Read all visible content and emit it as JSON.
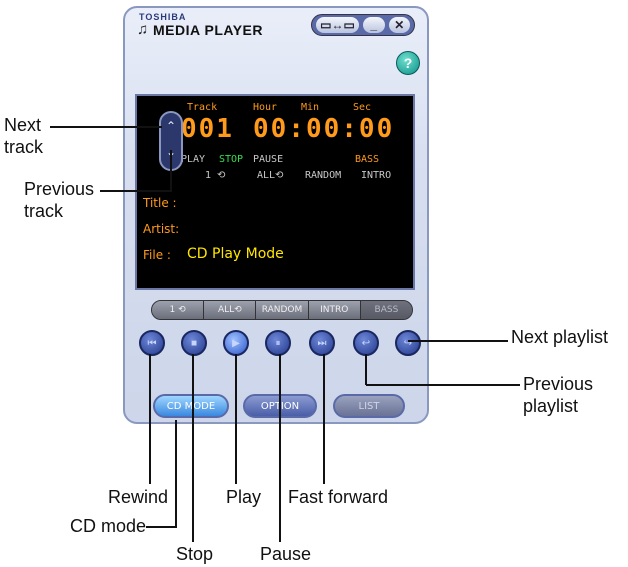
{
  "player": {
    "brand_small": "TOSHIBA",
    "title": "MEDIA PLAYER",
    "help": "?",
    "window_buttons": [
      "▭↔▭",
      "_",
      "✕"
    ],
    "display": {
      "labels": {
        "track": "Track",
        "hour": "Hour",
        "min": "Min",
        "sec": "Sec"
      },
      "track": "001",
      "time": "00:00:00",
      "status": {
        "play": "PLAY",
        "stop": "STOP",
        "pause": "PAUSE",
        "bass": "BASS"
      },
      "modes": {
        "one": "1 ⟲",
        "all": "ALL⟲",
        "random": "RANDOM",
        "intro": "INTRO"
      },
      "fields": {
        "title": "Title :",
        "artist": "Artist:",
        "file": "File  :",
        "file_value": "CD Play Mode"
      }
    },
    "mode_bar": [
      "1 ⟲",
      "ALL⟲",
      "RANDOM",
      "INTRO",
      "BASS"
    ],
    "controls": [
      "⏮",
      "■",
      "▶",
      "⏸",
      "⏭",
      "↩",
      "↪"
    ],
    "bottom": {
      "cd_mode": "CD MODE",
      "option": "OPTION",
      "list": "LIST"
    }
  },
  "callouts": {
    "next_track": "Next\ntrack",
    "previous_track": "Previous\ntrack",
    "next_playlist": "Next playlist",
    "previous_playlist": "Previous\nplaylist",
    "rewind": "Rewind",
    "cd_mode": "CD mode",
    "stop": "Stop",
    "play": "Play",
    "pause": "Pause",
    "fast_forward": "Fast forward"
  },
  "colors": {
    "display_orange": "#ff9a1a",
    "stop_green": "#33e04a",
    "file_yellow": "#ffe600"
  }
}
